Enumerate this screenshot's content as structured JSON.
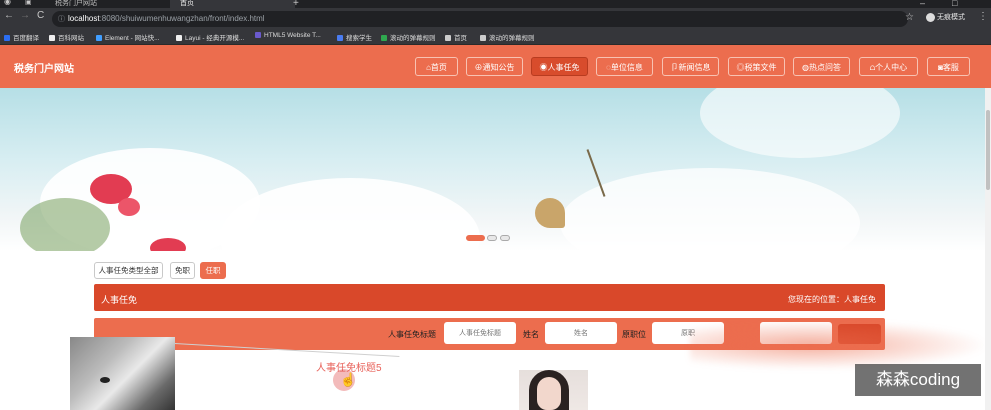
{
  "browser": {
    "tabs": [
      {
        "title": "税务门户网站",
        "active": false
      },
      {
        "title": "首页",
        "active": true
      }
    ],
    "new_tab": "+",
    "window_controls": [
      "–",
      "□"
    ],
    "nav": {
      "back": "←",
      "forward": "→",
      "reload": "C"
    },
    "url_host": "localhost",
    "url_rest": ":8080/shuiwumenhuwangzhan/front/index.html",
    "profile_label": "无痕模式",
    "bookmarks": [
      {
        "label": "百度翻译",
        "color": "#2b6ef2"
      },
      {
        "label": "百科网站",
        "color": "#eeeeee"
      },
      {
        "label": "Element - 网站快...",
        "color": "#409eff"
      },
      {
        "label": "Layui - 经典开源模...",
        "color": "#eeeeee"
      },
      {
        "label": "HTML5 Website T...",
        "color": "#6a5acd"
      },
      {
        "label": "搜索学生",
        "color": "#4a7cf0"
      },
      {
        "label": "滚动的弹幕规则",
        "color": "#2fa84f"
      },
      {
        "label": "首页",
        "color": "#cccccc"
      },
      {
        "label": "滚动的弹幕规则",
        "color": "#cccccc"
      }
    ]
  },
  "header": {
    "logo": "税务门户网站",
    "nav": [
      {
        "label": "⌂首页",
        "active": false
      },
      {
        "label": "⊕通知公告",
        "active": false
      },
      {
        "label": "◉人事任免",
        "active": true
      },
      {
        "label": "◌单位信息",
        "active": false
      },
      {
        "label": "卩新闻信息",
        "active": false
      },
      {
        "label": "◎税策文件",
        "active": false
      },
      {
        "label": "◍热点问答",
        "active": false
      },
      {
        "label": "⩍个人中心",
        "active": false
      },
      {
        "label": "◙客服",
        "active": false
      }
    ]
  },
  "banner": {
    "slides": 3,
    "active_slide": 0
  },
  "filters": [
    {
      "label": "人事任免类型全部",
      "active": false
    },
    {
      "label": "免职",
      "active": false
    },
    {
      "label": "任职",
      "active": true
    }
  ],
  "section": {
    "title": "人事任免",
    "location": "您现在的位置：人事任免"
  },
  "search": {
    "fields": [
      {
        "label": "人事任免标题",
        "placeholder": "人事任免标题"
      },
      {
        "label": "姓名",
        "placeholder": "姓名"
      },
      {
        "label": "原职位",
        "placeholder": "原职"
      }
    ]
  },
  "list": {
    "items": [
      {
        "title": "人事任免标题5"
      }
    ]
  },
  "watermark": "森森coding",
  "colors": {
    "primary": "#ec6d4e",
    "primary_dark": "#d9482a"
  }
}
